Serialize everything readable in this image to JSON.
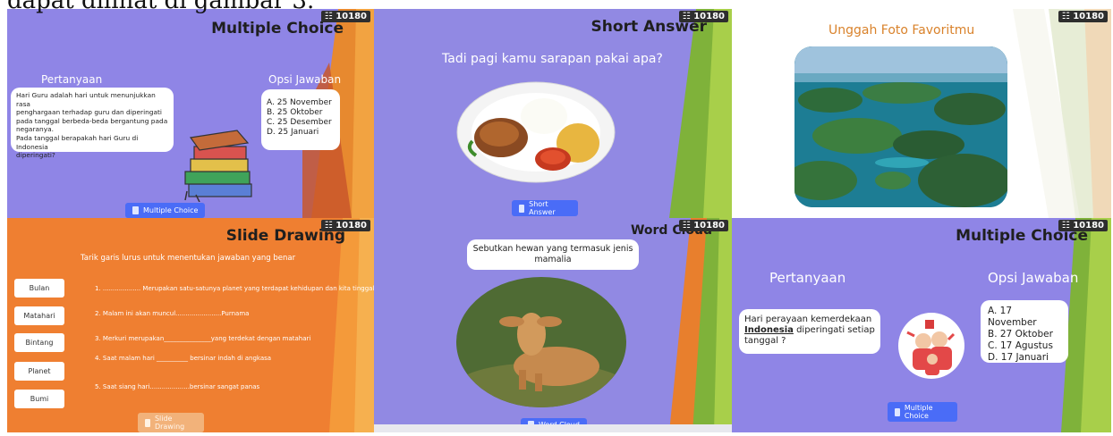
{
  "caption": {
    "text": "dapat dilihat di gambar 3."
  },
  "slides": {
    "mc1": {
      "badge": "10180",
      "title": "Multiple Choice",
      "question_label": "Pertanyaan",
      "options_label": "Opsi Jawaban",
      "question_lines": [
        "Hari Guru adalah hari untuk menunjukkan rasa",
        "penghargaan terhadap guru dan diperingati",
        "pada tanggal berbeda-beda bergantung pada",
        "negaranya.",
        "Pada tanggal berapakah hari Guru di Indonesia",
        "diperingati?"
      ],
      "options": [
        "A.  25 November",
        "B.  25 Oktober",
        "C.  25 Desember",
        "D.  25 Januari"
      ],
      "button": "Multiple Choice"
    },
    "sa": {
      "badge": "10180",
      "title": "Short  Answer",
      "question": "Tadi pagi kamu sarapan pakai apa?",
      "button": "Short Answer"
    },
    "upload": {
      "badge": "10180",
      "title": "Unggah Foto Favoritmu"
    },
    "drawing": {
      "badge": "10180",
      "title": "Slide Drawing",
      "instruction": "Tarik garis lurus untuk menentukan jawaban yang benar",
      "words": [
        "Bulan",
        "Matahari",
        "Bintang",
        "Planet",
        "Bumi"
      ],
      "sentences": [
        "1. ...................  Merupakan satu-satunya planet yang terdapat kehidupan dan kita tinggali",
        "2. Malam ini akan muncul.......................Purnama",
        "3. Merkuri merupakan_______________yang terdekat dengan matahari",
        "4. Saat malam hari __________ bersinar indah di angkasa",
        "5. Saat siang hari....................bersinar sangat panas"
      ],
      "button": "Slide Drawing"
    },
    "wordcloud": {
      "badge": "10180",
      "title": "Word Cloud",
      "question_line1": "Sebutkan hewan yang termasuk jenis",
      "question_line2": "mamalia",
      "button": "Word Cloud"
    },
    "mc2": {
      "badge": "10180",
      "title": "Multiple Choice",
      "question_label": "Pertanyaan",
      "options_label": "Opsi Jawaban",
      "question_lines": [
        "Hari perayaan kemerdekaan",
        "Indonesia diperingati setiap",
        "tanggal ?"
      ],
      "options": [
        "A. 17 November",
        "B. 27 Oktober",
        "C. 17 Agustus",
        "D. 17 Januari"
      ],
      "button": "Multiple Choice"
    }
  },
  "colors": {
    "purple_bg": "#8f85e6",
    "orange_bg": "#ef7f31",
    "button_blue": "#4a6cf7",
    "title_orange": "#d9822b"
  }
}
